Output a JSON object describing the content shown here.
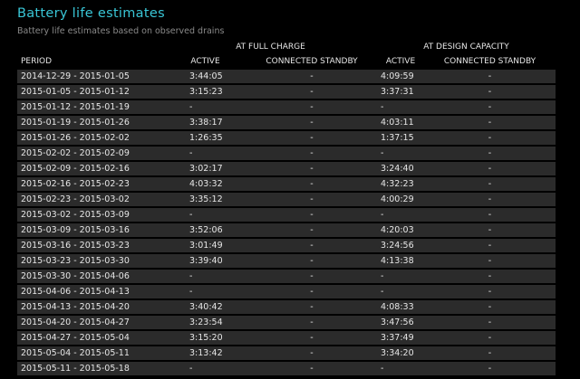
{
  "report": {
    "title": "Battery life estimates",
    "subtitle": "Battery life estimates based on observed drains"
  },
  "table": {
    "group_headers": {
      "full_charge": "AT FULL CHARGE",
      "design_capacity": "AT DESIGN CAPACITY"
    },
    "columns": {
      "period": "PERIOD",
      "fc_active": "ACTIVE",
      "fc_standby": "CONNECTED STANDBY",
      "dc_active": "ACTIVE",
      "dc_standby": "CONNECTED STANDBY"
    },
    "rows": [
      {
        "period": "2014-12-29 - 2015-01-05",
        "fc_active": "3:44:05",
        "fc_standby": "-",
        "dc_active": "4:09:59",
        "dc_standby": "-"
      },
      {
        "period": "2015-01-05 - 2015-01-12",
        "fc_active": "3:15:23",
        "fc_standby": "-",
        "dc_active": "3:37:31",
        "dc_standby": "-"
      },
      {
        "period": "2015-01-12 - 2015-01-19",
        "fc_active": "-",
        "fc_standby": "-",
        "dc_active": "-",
        "dc_standby": "-"
      },
      {
        "period": "2015-01-19 - 2015-01-26",
        "fc_active": "3:38:17",
        "fc_standby": "-",
        "dc_active": "4:03:11",
        "dc_standby": "-"
      },
      {
        "period": "2015-01-26 - 2015-02-02",
        "fc_active": "1:26:35",
        "fc_standby": "-",
        "dc_active": "1:37:15",
        "dc_standby": "-"
      },
      {
        "period": "2015-02-02 - 2015-02-09",
        "fc_active": "-",
        "fc_standby": "-",
        "dc_active": "-",
        "dc_standby": "-"
      },
      {
        "period": "2015-02-09 - 2015-02-16",
        "fc_active": "3:02:17",
        "fc_standby": "-",
        "dc_active": "3:24:40",
        "dc_standby": "-"
      },
      {
        "period": "2015-02-16 - 2015-02-23",
        "fc_active": "4:03:32",
        "fc_standby": "-",
        "dc_active": "4:32:23",
        "dc_standby": "-"
      },
      {
        "period": "2015-02-23 - 2015-03-02",
        "fc_active": "3:35:12",
        "fc_standby": "-",
        "dc_active": "4:00:29",
        "dc_standby": "-"
      },
      {
        "period": "2015-03-02 - 2015-03-09",
        "fc_active": "-",
        "fc_standby": "-",
        "dc_active": "-",
        "dc_standby": "-"
      },
      {
        "period": "2015-03-09 - 2015-03-16",
        "fc_active": "3:52:06",
        "fc_standby": "-",
        "dc_active": "4:20:03",
        "dc_standby": "-"
      },
      {
        "period": "2015-03-16 - 2015-03-23",
        "fc_active": "3:01:49",
        "fc_standby": "-",
        "dc_active": "3:24:56",
        "dc_standby": "-"
      },
      {
        "period": "2015-03-23 - 2015-03-30",
        "fc_active": "3:39:40",
        "fc_standby": "-",
        "dc_active": "4:13:38",
        "dc_standby": "-"
      },
      {
        "period": "2015-03-30 - 2015-04-06",
        "fc_active": "-",
        "fc_standby": "-",
        "dc_active": "-",
        "dc_standby": "-"
      },
      {
        "period": "2015-04-06 - 2015-04-13",
        "fc_active": "-",
        "fc_standby": "-",
        "dc_active": "-",
        "dc_standby": "-"
      },
      {
        "period": "2015-04-13 - 2015-04-20",
        "fc_active": "3:40:42",
        "fc_standby": "-",
        "dc_active": "4:08:33",
        "dc_standby": "-"
      },
      {
        "period": "2015-04-20 - 2015-04-27",
        "fc_active": "3:23:54",
        "fc_standby": "-",
        "dc_active": "3:47:56",
        "dc_standby": "-"
      },
      {
        "period": "2015-04-27 - 2015-05-04",
        "fc_active": "3:15:20",
        "fc_standby": "-",
        "dc_active": "3:37:49",
        "dc_standby": "-"
      },
      {
        "period": "2015-05-04 - 2015-05-11",
        "fc_active": "3:13:42",
        "fc_standby": "-",
        "dc_active": "3:34:20",
        "dc_standby": "-"
      },
      {
        "period": "2015-05-11 - 2015-05-18",
        "fc_active": "-",
        "fc_standby": "-",
        "dc_active": "-",
        "dc_standby": "-"
      }
    ]
  },
  "colors": {
    "background": "#000000",
    "row_background": "#2b2b2b",
    "title_accent": "#39c6d6",
    "text": "#e6e6e6",
    "subtitle_text": "#8a8a8a"
  }
}
